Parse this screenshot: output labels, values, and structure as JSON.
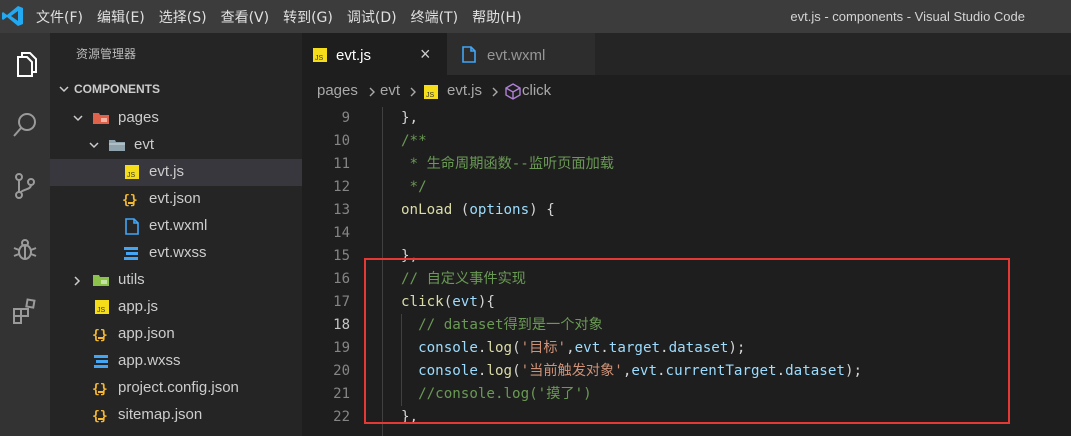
{
  "titlebar": {
    "menu": [
      "文件(F)",
      "编辑(E)",
      "选择(S)",
      "查看(V)",
      "转到(G)",
      "调试(D)",
      "终端(T)",
      "帮助(H)"
    ],
    "window_title": "evt.js - components - Visual Studio Code"
  },
  "activity_bar": [
    "files-icon",
    "search-icon",
    "source-control-icon",
    "debug-icon",
    "extensions-icon"
  ],
  "sidebar": {
    "title": "资源管理器",
    "section": "COMPONENTS",
    "tree": [
      {
        "label": "pages",
        "icon": "folder-pages-icon",
        "expanded": true
      },
      {
        "label": "evt",
        "icon": "folder-icon",
        "expanded": true
      },
      {
        "label": "evt.js",
        "icon": "js-file-icon",
        "active": true
      },
      {
        "label": "evt.json",
        "icon": "json-file-icon"
      },
      {
        "label": "evt.wxml",
        "icon": "wxml-file-icon"
      },
      {
        "label": "evt.wxss",
        "icon": "css-file-icon"
      },
      {
        "label": "utils",
        "icon": "folder-utils-icon",
        "expanded": false
      },
      {
        "label": "app.js",
        "icon": "js-file-icon"
      },
      {
        "label": "app.json",
        "icon": "json-file-icon"
      },
      {
        "label": "app.wxss",
        "icon": "css-file-icon"
      },
      {
        "label": "project.config.json",
        "icon": "json-file-icon"
      },
      {
        "label": "sitemap.json",
        "icon": "json-file-icon"
      }
    ]
  },
  "tabs": [
    {
      "label": "evt.js",
      "active": true,
      "close": "×"
    },
    {
      "label": "evt.wxml",
      "active": false
    }
  ],
  "breadcrumb": [
    "pages",
    "evt",
    "evt.js",
    "click"
  ],
  "editor": {
    "current_line": 18,
    "lines": [
      {
        "num": "9",
        "text": "},"
      },
      {
        "num": "10",
        "text": "/**"
      },
      {
        "num": "11",
        "text": " * 生命周期函数--监听页面加载"
      },
      {
        "num": "12",
        "text": " */"
      },
      {
        "num": "13",
        "text": "onLoad (options) {"
      },
      {
        "num": "14",
        "text": ""
      },
      {
        "num": "15",
        "text": "},"
      },
      {
        "num": "16",
        "text": "// 自定义事件实现"
      },
      {
        "num": "17",
        "text": "click(evt){"
      },
      {
        "num": "18",
        "text": "  // dataset得到是一个对象"
      },
      {
        "num": "19",
        "text": "  console.log('目标',evt.target.dataset);"
      },
      {
        "num": "20",
        "text": "  console.log('当前触发对象',evt.currentTarget.dataset);"
      },
      {
        "num": "21",
        "text": "  //console.log('摸了')"
      },
      {
        "num": "22",
        "text": "},"
      }
    ]
  },
  "colors": {
    "titlebar": "#3c3c3c",
    "activity_bar": "#333333",
    "sidebar": "#252526",
    "editor": "#1e1e1e",
    "highlight_box": "#e53935",
    "comment": "#6a9955",
    "string": "#ce9178",
    "function": "#dcdcaa",
    "variable": "#9cdcfe"
  }
}
